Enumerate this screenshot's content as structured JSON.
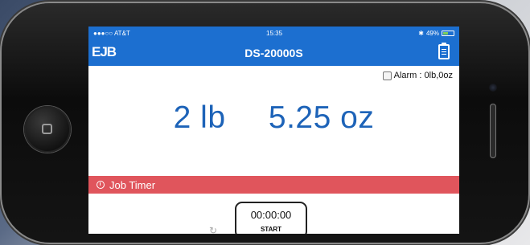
{
  "status_bar": {
    "carrier": "●●●○○ AT&T",
    "time": "15:35",
    "battery": "49%"
  },
  "nav": {
    "logo": "EJB",
    "title": "DS-20000S"
  },
  "alarm": {
    "label": "Alarm : 0lb,0oz",
    "checked": false
  },
  "weight": {
    "pounds": "2 lb",
    "ounces": "5.25 oz"
  },
  "job_timer": {
    "label": "Job Timer",
    "time": "00:00:00",
    "start_label": "START"
  },
  "colors": {
    "accent": "#1c6fd0",
    "timer_bar": "#e0555c",
    "weight_text": "#1d63b8"
  }
}
